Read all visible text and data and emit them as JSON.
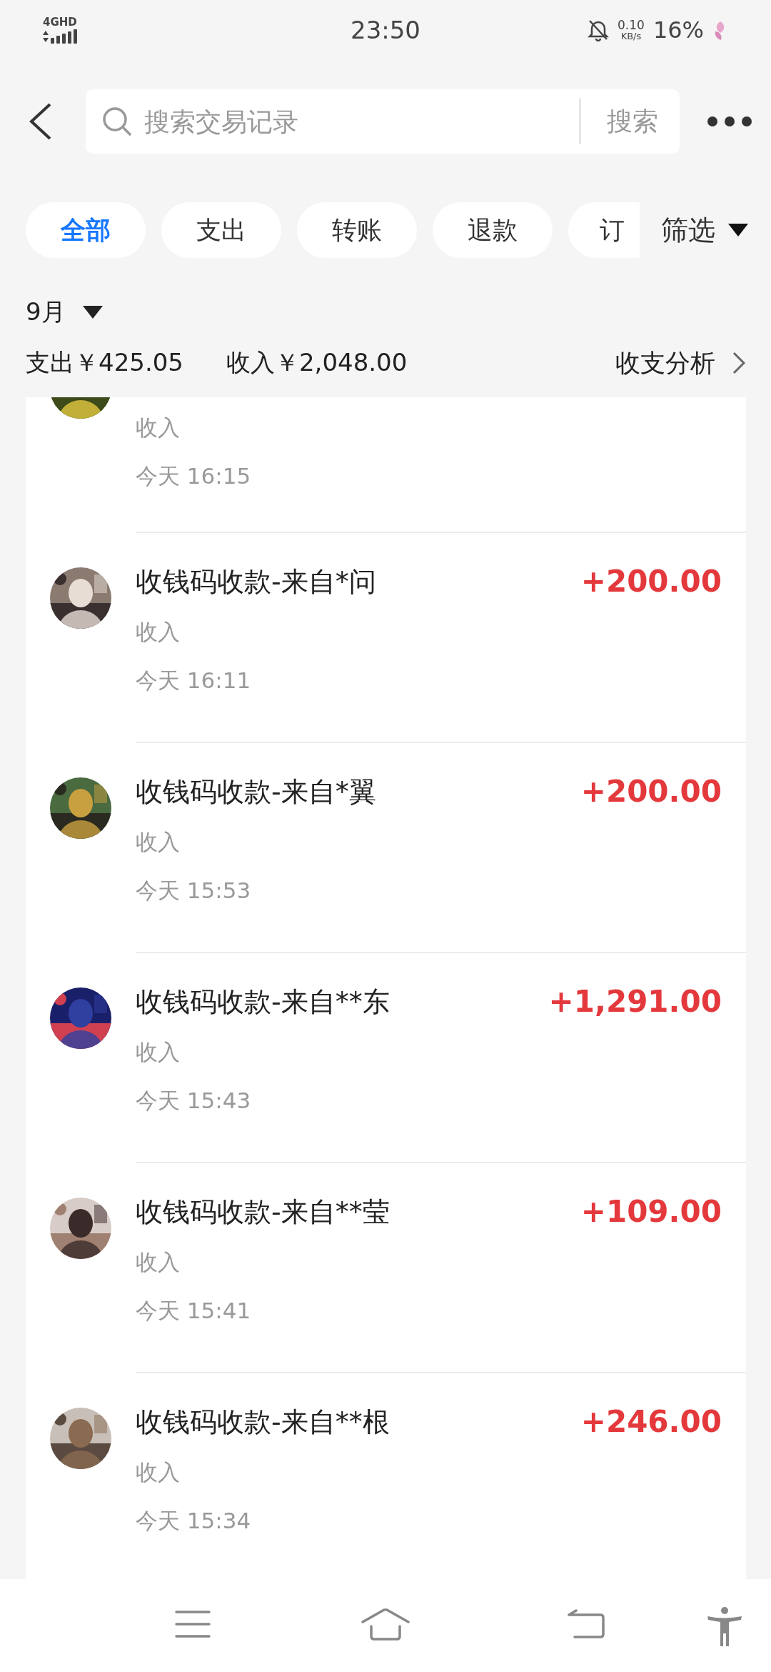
{
  "status_bar": {
    "network": "4GHD",
    "time": "23:50",
    "speed": "0.10",
    "speed_unit": "KB/s",
    "battery": "16%"
  },
  "search": {
    "placeholder": "搜索交易记录",
    "button": "搜索"
  },
  "filters": [
    {
      "label": "全部",
      "selected": true
    },
    {
      "label": "支出",
      "selected": false
    },
    {
      "label": "转账",
      "selected": false
    },
    {
      "label": "退款",
      "selected": false
    },
    {
      "label": "订",
      "selected": false
    }
  ],
  "filter_button": "筛选",
  "month": "9月",
  "summary": {
    "expense": "支出￥425.05",
    "income": "收入￥2,048.00",
    "analysis": "收支分析"
  },
  "transactions": [
    {
      "kind": "partial",
      "category": "收入",
      "time": "今天 16:15"
    },
    {
      "kind": "full",
      "title": "收钱码收款-来自*问",
      "amount": "+200.00",
      "category": "收入",
      "time": "今天 16:11"
    },
    {
      "kind": "full",
      "title": "收钱码收款-来自*翼",
      "amount": "+200.00",
      "category": "收入",
      "time": "今天 15:53"
    },
    {
      "kind": "full",
      "title": "收钱码收款-来自**东",
      "amount": "+1,291.00",
      "category": "收入",
      "time": "今天 15:43"
    },
    {
      "kind": "full",
      "title": "收钱码收款-来自**莹",
      "amount": "+109.00",
      "category": "收入",
      "time": "今天 15:41"
    },
    {
      "kind": "full",
      "title": "收钱码收款-来自**根",
      "amount": "+246.00",
      "category": "收入",
      "time": "今天 15:34"
    }
  ]
}
